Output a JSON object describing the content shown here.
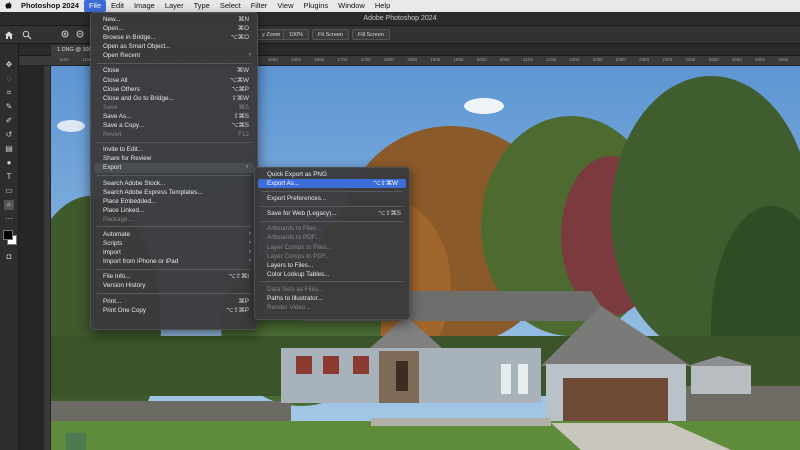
{
  "menubar": {
    "app": "Photoshop 2024",
    "items": [
      "File",
      "Edit",
      "Image",
      "Layer",
      "Type",
      "Select",
      "Filter",
      "View",
      "Plugins",
      "Window",
      "Help"
    ],
    "active": "File"
  },
  "window": {
    "title": "Adobe Photoshop 2024"
  },
  "options": {
    "btn_zoom": "y Zoom",
    "btn_100": "100%",
    "btn_fit": "Fit Screen",
    "btn_fill": "Fill Screen"
  },
  "tab": {
    "label": "1.DNG @ 100% (R"
  },
  "ruler": {
    "ticks": [
      "1100",
      "1150",
      "1200",
      "1250",
      "1300",
      "1350",
      "1400",
      "1450",
      "1500",
      "1550",
      "1600",
      "1650",
      "1700",
      "1750",
      "1800",
      "1850",
      "1900",
      "1950",
      "2000",
      "2050",
      "2100",
      "2150",
      "2200",
      "2250",
      "2300",
      "2350",
      "2400",
      "2450",
      "2500",
      "2550",
      "2600",
      "2650",
      "2700",
      "2750"
    ]
  },
  "file_menu": [
    {
      "label": "New...",
      "shortcut": "⌘N"
    },
    {
      "label": "Open...",
      "shortcut": "⌘O"
    },
    {
      "label": "Browse in Bridge...",
      "shortcut": "⌥⌘O"
    },
    {
      "label": "Open as Smart Object...",
      "shortcut": ""
    },
    {
      "label": "Open Recent",
      "shortcut": "",
      "submenu": true
    },
    {
      "sep": true
    },
    {
      "label": "Close",
      "shortcut": "⌘W"
    },
    {
      "label": "Close All",
      "shortcut": "⌥⌘W"
    },
    {
      "label": "Close Others",
      "shortcut": "⌥⌘P"
    },
    {
      "label": "Close and Go to Bridge...",
      "shortcut": "⇧⌘W"
    },
    {
      "label": "Save",
      "shortcut": "⌘S",
      "disabled": true
    },
    {
      "label": "Save As...",
      "shortcut": "⇧⌘S"
    },
    {
      "label": "Save a Copy...",
      "shortcut": "⌥⌘S"
    },
    {
      "label": "Revert",
      "shortcut": "F12",
      "disabled": true
    },
    {
      "sep": true
    },
    {
      "label": "Invite to Edit...",
      "shortcut": ""
    },
    {
      "label": "Share for Review",
      "shortcut": ""
    },
    {
      "label": "Export",
      "shortcut": "",
      "submenu": true,
      "highlight_soft": true
    },
    {
      "sep": true
    },
    {
      "label": "Search Adobe Stock...",
      "shortcut": ""
    },
    {
      "label": "Search Adobe Express Templates...",
      "shortcut": ""
    },
    {
      "label": "Place Embedded...",
      "shortcut": ""
    },
    {
      "label": "Place Linked...",
      "shortcut": ""
    },
    {
      "label": "Package...",
      "shortcut": "",
      "disabled": true
    },
    {
      "sep": true
    },
    {
      "label": "Automate",
      "shortcut": "",
      "submenu": true
    },
    {
      "label": "Scripts",
      "shortcut": "",
      "submenu": true
    },
    {
      "label": "Import",
      "shortcut": "",
      "submenu": true
    },
    {
      "label": "Import from iPhone or iPad",
      "shortcut": "",
      "submenu": true
    },
    {
      "sep": true
    },
    {
      "label": "File Info...",
      "shortcut": "⌥⇧⌘I"
    },
    {
      "label": "Version History",
      "shortcut": ""
    },
    {
      "sep": true
    },
    {
      "label": "Print...",
      "shortcut": "⌘P"
    },
    {
      "label": "Print One Copy",
      "shortcut": "⌥⇧⌘P"
    }
  ],
  "export_menu": [
    {
      "label": "Quick Export as PNG",
      "shortcut": ""
    },
    {
      "label": "Export As...",
      "shortcut": "⌥⇧⌘W",
      "highlight": true
    },
    {
      "sep": true
    },
    {
      "label": "Export Preferences...",
      "shortcut": ""
    },
    {
      "sep": true
    },
    {
      "label": "Save for Web (Legacy)...",
      "shortcut": "⌥⇧⌘S"
    },
    {
      "sep": true
    },
    {
      "label": "Artboards to Files...",
      "shortcut": "",
      "disabled": true
    },
    {
      "label": "Artboards to PDF...",
      "shortcut": "",
      "disabled": true
    },
    {
      "label": "Layer Comps to Files...",
      "shortcut": "",
      "disabled": true
    },
    {
      "label": "Layer Comps to PDF...",
      "shortcut": "",
      "disabled": true
    },
    {
      "label": "Layers to Files...",
      "shortcut": ""
    },
    {
      "label": "Color Lookup Tables...",
      "shortcut": ""
    },
    {
      "sep": true
    },
    {
      "label": "Data Sets as Files...",
      "shortcut": "",
      "disabled": true
    },
    {
      "label": "Paths to Illustrator...",
      "shortcut": ""
    },
    {
      "label": "Render Video...",
      "shortcut": "",
      "disabled": true
    }
  ],
  "icons": {
    "home": "home-icon",
    "zoom": "zoom-icon",
    "apple": "apple-icon"
  }
}
